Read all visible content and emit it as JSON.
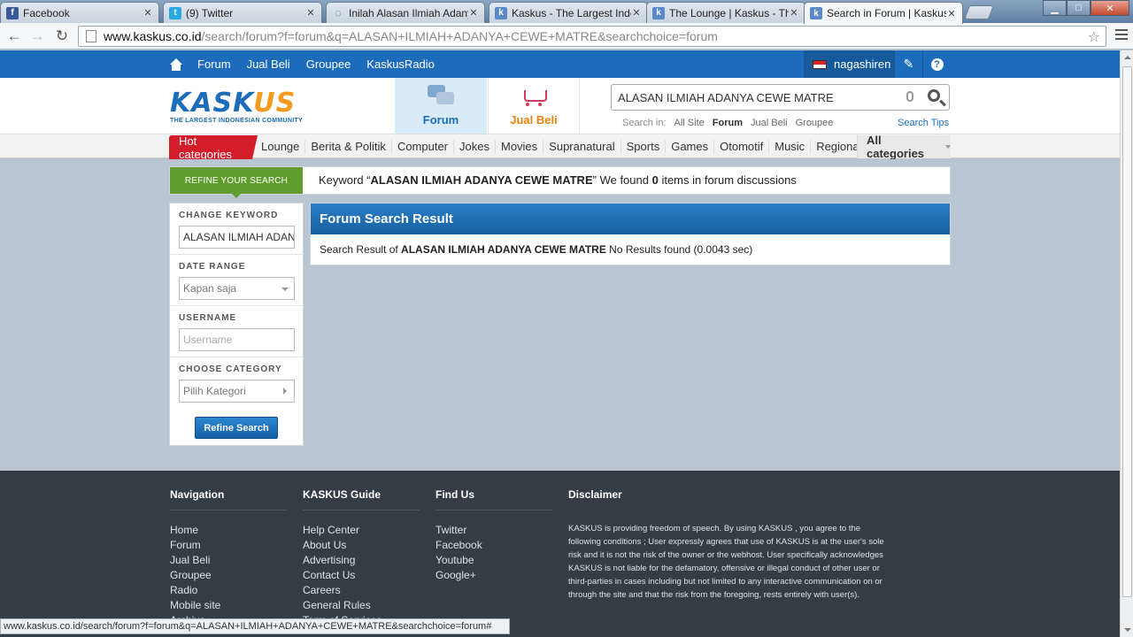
{
  "browser": {
    "tabs": [
      {
        "title": "Facebook",
        "favicon": "facebook-favicon",
        "favcolor": "#3b5998",
        "glyph": "f"
      },
      {
        "title": "(9) Twitter",
        "favicon": "twitter-favicon",
        "favcolor": "#2aa9e0",
        "glyph": "t"
      },
      {
        "title": "Inilah Alasan Ilmiah Adany",
        "favicon": "loading-favicon",
        "favcolor": "#ffffff",
        "glyph": "◌"
      },
      {
        "title": "Kaskus - The Largest Indo",
        "favicon": "kaskus-favicon",
        "favcolor": "#5a88c9",
        "glyph": "k"
      },
      {
        "title": "The Lounge | Kaskus - The",
        "favicon": "kaskus-favicon",
        "favcolor": "#5a88c9",
        "glyph": "k"
      },
      {
        "title": "Search in Forum | Kaskus -",
        "favicon": "kaskus-favicon",
        "favcolor": "#5a88c9",
        "glyph": "k"
      }
    ],
    "url_host": "www.kaskus.co.id",
    "url_path": "/search/forum?f=forum&q=ALASAN+ILMIAH+ADANYA+CEWE+MATRE&searchchoice=forum",
    "status_url": "www.kaskus.co.id/search/forum?f=forum&q=ALASAN+ILMIAH+ADANYA+CEWE+MATRE&searchchoice=forum#"
  },
  "topbar": {
    "links": [
      "Forum",
      "Jual Beli",
      "Groupee",
      "KaskusRadio"
    ],
    "username": "nagashiren"
  },
  "header": {
    "logo_main": "KASKUS",
    "logo_tag": "THE LARGEST INDONESIAN COMMUNITY",
    "section_forum": "Forum",
    "section_jualbeli": "Jual Beli",
    "search_value": "ALASAN ILMIAH ADANYA CEWE MATRE",
    "search_in_label": "Search in:",
    "search_in_options": [
      "All Site",
      "Forum",
      "Jual Beli",
      "Groupee"
    ],
    "search_tips": "Search Tips"
  },
  "catnav": {
    "hot": "Hot categories",
    "items": [
      "Lounge",
      "Berita & Politik",
      "Computer",
      "Jokes",
      "Movies",
      "Supranatural",
      "Sports",
      "Games",
      "Otomotif",
      "Music",
      "Regional"
    ],
    "all": "All categories"
  },
  "refine": {
    "tab_label": "REFINE YOUR SEARCH",
    "msg_pre": "Keyword “",
    "msg_keyword": "ALASAN ILMIAH ADANYA CEWE MATRE",
    "msg_mid": "” We found ",
    "msg_count": "0",
    "msg_post": " items in forum discussions"
  },
  "sidebar": {
    "change_keyword_label": "CHANGE KEYWORD",
    "keyword_value": "ALASAN ILMIAH ADANYA CEWE MATRE",
    "date_range_label": "DATE RANGE",
    "date_range_value": "Kapan saja",
    "username_label": "USERNAME",
    "username_placeholder": "Username",
    "category_label": "CHOOSE CATEGORY",
    "category_value": "Pilih Kategori",
    "refine_button": "Refine Search"
  },
  "result": {
    "title": "Forum Search Result",
    "pre": "Search Result of ",
    "keyword": "ALASAN ILMIAH ADANYA CEWE MATRE",
    "post": " No Results found (0.0043 sec)"
  },
  "footer": {
    "navigation": {
      "title": "Navigation",
      "links": [
        "Home",
        "Forum",
        "Jual Beli",
        "Groupee",
        "Radio",
        "Mobile site",
        "Archive"
      ]
    },
    "guide": {
      "title": "KASKUS Guide",
      "links": [
        "Help Center",
        "About Us",
        "Advertising",
        "Contact Us",
        "Careers",
        "General Rules",
        "Term of Services"
      ]
    },
    "findus": {
      "title": "Find Us",
      "links": [
        "Twitter",
        "Facebook",
        "Youtube",
        "Google+"
      ]
    },
    "disclaimer": {
      "title": "Disclaimer",
      "text": "KASKUS is providing freedom of speech. By using KASKUS , you agree to the following conditions ; User expressly agrees that use of KASKUS is at the user's sole risk and it is not the risk of the owner or the webhost. User specifically acknowledges KASKUS is not liable for the defamatory, offensive or illegal conduct of other user or third-parties in cases including but not limited to any interactive communication on or through the site and that the risk from the foregoing, rests entirely with user(s)."
    }
  }
}
